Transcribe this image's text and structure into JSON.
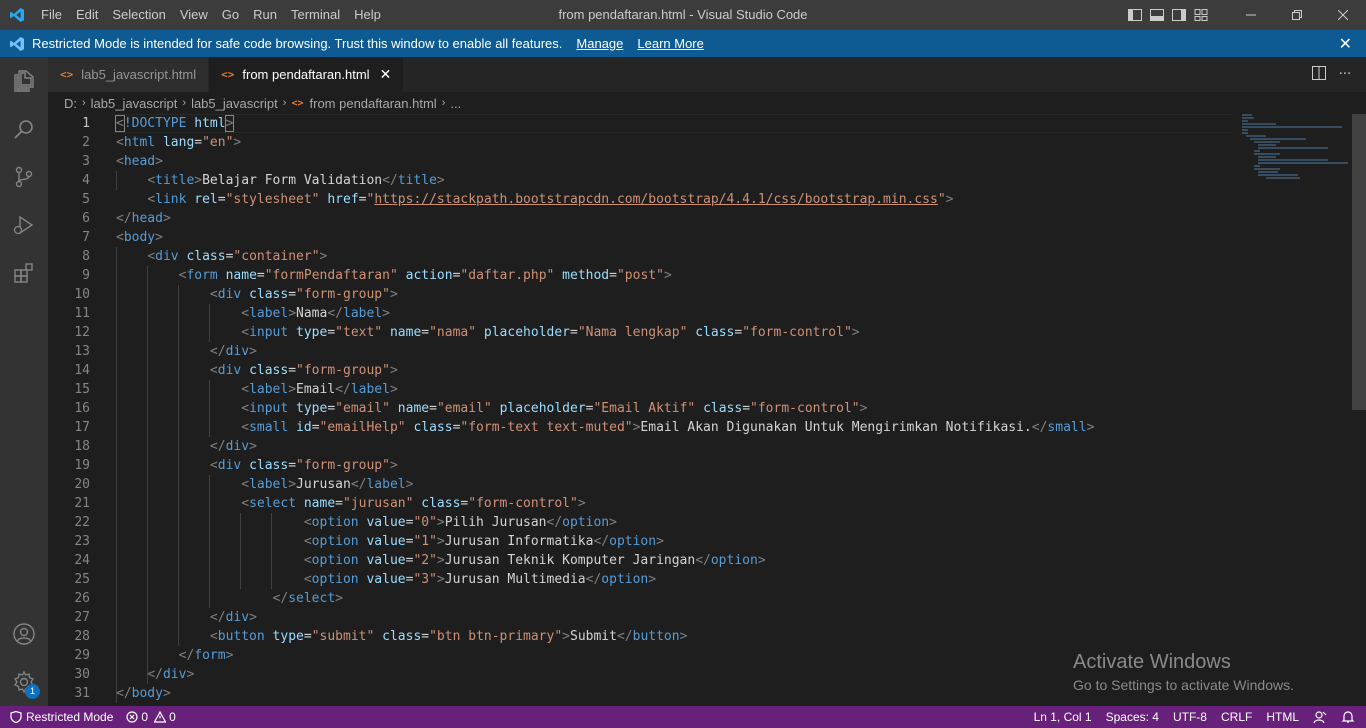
{
  "window": {
    "title": "from pendaftaran.html - Visual Studio Code",
    "menu": [
      "File",
      "Edit",
      "Selection",
      "View",
      "Go",
      "Run",
      "Terminal",
      "Help"
    ]
  },
  "banner": {
    "message": "Restricted Mode is intended for safe code browsing. Trust this window to enable all features.",
    "manage": "Manage",
    "learn_more": "Learn More"
  },
  "tabs": [
    {
      "label": "lab5_javascript.html",
      "active": false
    },
    {
      "label": "from pendaftaran.html",
      "active": true
    }
  ],
  "breadcrumb": {
    "drive": "D:",
    "folder1": "lab5_javascript",
    "folder2": "lab5_javascript",
    "file": "from pendaftaran.html",
    "more": "..."
  },
  "editor": {
    "current_line": 1,
    "line_numbers": [
      "1",
      "2",
      "3",
      "4",
      "5",
      "6",
      "7",
      "8",
      "9",
      "10",
      "11",
      "12",
      "13",
      "14",
      "15",
      "16",
      "17",
      "18",
      "19",
      "20",
      "21",
      "22",
      "23",
      "24",
      "25",
      "26",
      "27",
      "28",
      "29",
      "30",
      "31"
    ]
  },
  "watermark": {
    "line1": "Activate Windows",
    "line2": "Go to Settings to activate Windows."
  },
  "statusbar": {
    "restricted": "Restricted Mode",
    "errors": "0",
    "warnings": "0",
    "position": "Ln 1, Col 1",
    "spaces": "Spaces: 4",
    "encoding": "UTF-8",
    "eol": "CRLF",
    "language": "HTML"
  },
  "accounts_badge": "1",
  "colors": {
    "titlebar": "#3c3c3c",
    "banner": "#0e5b93",
    "statusbar": "#68217a",
    "editor_bg": "#1e1e1e"
  }
}
